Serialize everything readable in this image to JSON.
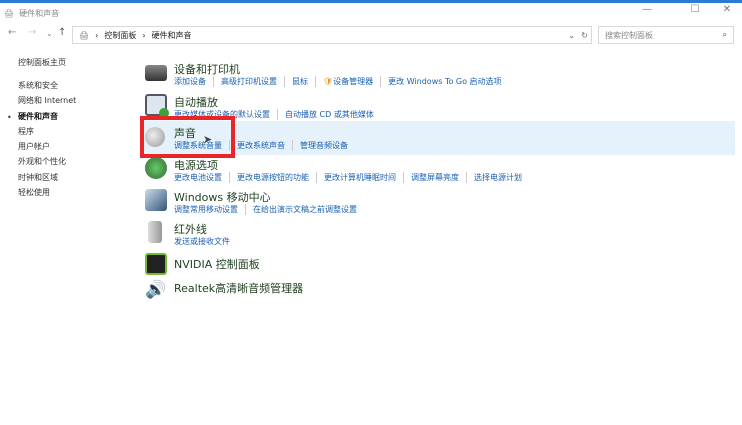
{
  "window": {
    "title": "硬件和声音",
    "minimize": "—",
    "maximize": "☐",
    "close": "✕"
  },
  "nav": {
    "back": "←",
    "forward": "→",
    "recent": "⌄",
    "up": "↑"
  },
  "address": {
    "crumbs": [
      "控制面板",
      "硬件和声音"
    ],
    "sep": "›",
    "dropdown": "⌄",
    "refresh": "↻"
  },
  "search": {
    "placeholder": "搜索控制面板",
    "icon": "⌕"
  },
  "sidebar": {
    "items": [
      "控制面板主页",
      "系统和安全",
      "网络和 Internet",
      "硬件和声音",
      "程序",
      "用户帐户",
      "外观和个性化",
      "时钟和区域",
      "轻松使用"
    ],
    "active_index": 3,
    "bullet": "•"
  },
  "categories": [
    {
      "title": "设备和打印机",
      "links": [
        "添加设备",
        "高级打印机设置",
        "鼠标",
        "设备管理器",
        "更改 Windows To Go 启动选项"
      ]
    },
    {
      "title": "自动播放",
      "links": [
        "更改媒体或设备的默认设置",
        "自动播放 CD 或其他媒体"
      ]
    },
    {
      "title": "声音",
      "links": [
        "调整系统音量",
        "更改系统声音",
        "管理音频设备"
      ]
    },
    {
      "title": "电源选项",
      "links": [
        "更改电池设置",
        "更改电源按钮的功能",
        "更改计算机睡眠时间",
        "调整屏幕亮度",
        "选择电源计划"
      ]
    },
    {
      "title": "Windows 移动中心",
      "links": [
        "调整常用移动设置",
        "在给出演示文稿之前调整设置"
      ]
    },
    {
      "title": "红外线",
      "links": [
        "发送或接收文件"
      ]
    },
    {
      "title": "NVIDIA 控制面板",
      "links": []
    },
    {
      "title": "Realtek高清晰音频管理器",
      "links": []
    }
  ],
  "colors": {
    "accent": "#2b7ad6",
    "link": "#1a5fb4",
    "highlight": "#e5f1fb",
    "annotation": "#e8262a"
  }
}
